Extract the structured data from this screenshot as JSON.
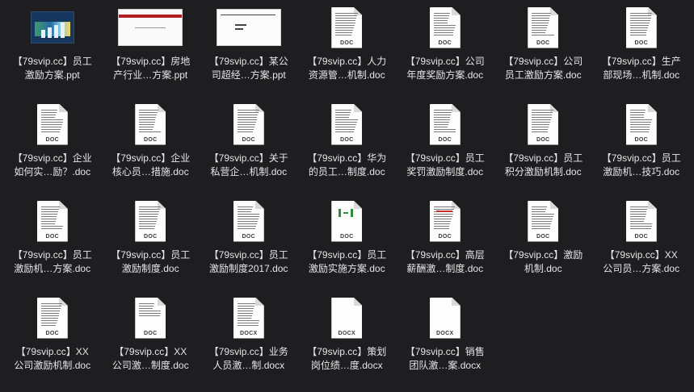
{
  "files": [
    {
      "name": "【79svip.cc】员工\n激励方案.ppt",
      "thumb": "ppt-blue"
    },
    {
      "name": "【79svip.cc】房地\n产行业…方案.ppt",
      "thumb": "ppt-white"
    },
    {
      "name": "【79svip.cc】某公\n司超经…方案.ppt",
      "thumb": "ppt-white2"
    },
    {
      "name": "【79svip.cc】人力\n资源管…机制.doc",
      "thumb": "doc",
      "badge": "DOC"
    },
    {
      "name": "【79svip.cc】公司\n年度奖励方案.doc",
      "thumb": "doc",
      "badge": "DOC"
    },
    {
      "name": "【79svip.cc】公司\n员工激励方案.doc",
      "thumb": "doc",
      "badge": "DOC",
      "variant": "green-mark"
    },
    {
      "name": "【79svip.cc】生产\n部现场…机制.doc",
      "thumb": "doc",
      "badge": "DOC",
      "variant": "color-table"
    },
    {
      "name": "【79svip.cc】企业\n如何实…励？.doc",
      "thumb": "doc",
      "badge": "DOC"
    },
    {
      "name": "【79svip.cc】企业\n核心员…措施.doc",
      "thumb": "doc",
      "badge": "DOC"
    },
    {
      "name": "【79svip.cc】关于\n私营企…机制.doc",
      "thumb": "doc",
      "badge": "DOC"
    },
    {
      "name": "【79svip.cc】华为\n的员工…制度.doc",
      "thumb": "doc",
      "badge": "DOC"
    },
    {
      "name": "【79svip.cc】员工\n奖罚激励制度.doc",
      "thumb": "doc",
      "badge": "DOC"
    },
    {
      "name": "【79svip.cc】员工\n积分激励机制.doc",
      "thumb": "doc",
      "badge": "DOC"
    },
    {
      "name": "【79svip.cc】员工\n激励机…技巧.doc",
      "thumb": "doc",
      "badge": "DOC"
    },
    {
      "name": "【79svip.cc】员工\n激励机…方案.doc",
      "thumb": "doc",
      "badge": "DOC"
    },
    {
      "name": "【79svip.cc】员工\n激励制度.doc",
      "thumb": "doc",
      "badge": "DOC"
    },
    {
      "name": "【79svip.cc】员工\n激励制度2017.doc",
      "thumb": "doc",
      "badge": "DOC"
    },
    {
      "name": "【79svip.cc】员工\n激励实施方案.doc",
      "thumb": "doc",
      "badge": "DOC",
      "variant": "green-logo"
    },
    {
      "name": "【79svip.cc】高层\n薪酬激…制度.doc",
      "thumb": "doc",
      "badge": "DOC",
      "variant": "red-title"
    },
    {
      "name": "【79svip.cc】激励\n机制.doc",
      "thumb": "doc",
      "badge": "DOC"
    },
    {
      "name": "【79svip.cc】XX\n公司员…方案.doc",
      "thumb": "doc",
      "badge": "DOC"
    },
    {
      "name": "【79svip.cc】XX\n公司激励机制.doc",
      "thumb": "doc",
      "badge": "DOC"
    },
    {
      "name": "【79svip.cc】XX\n公司激…制度.doc",
      "thumb": "doc",
      "badge": "DOC",
      "variant": "sparse"
    },
    {
      "name": "【79svip.cc】业务\n人员激…制.docx",
      "thumb": "doc",
      "badge": "DOCX"
    },
    {
      "name": "【79svip.cc】策划\n岗位绩…度.docx",
      "thumb": "doc",
      "badge": "DOCX",
      "variant": "blank"
    },
    {
      "name": "【79svip.cc】销售\n团队激…案.docx",
      "thumb": "doc",
      "badge": "DOCX",
      "variant": "blank"
    }
  ]
}
